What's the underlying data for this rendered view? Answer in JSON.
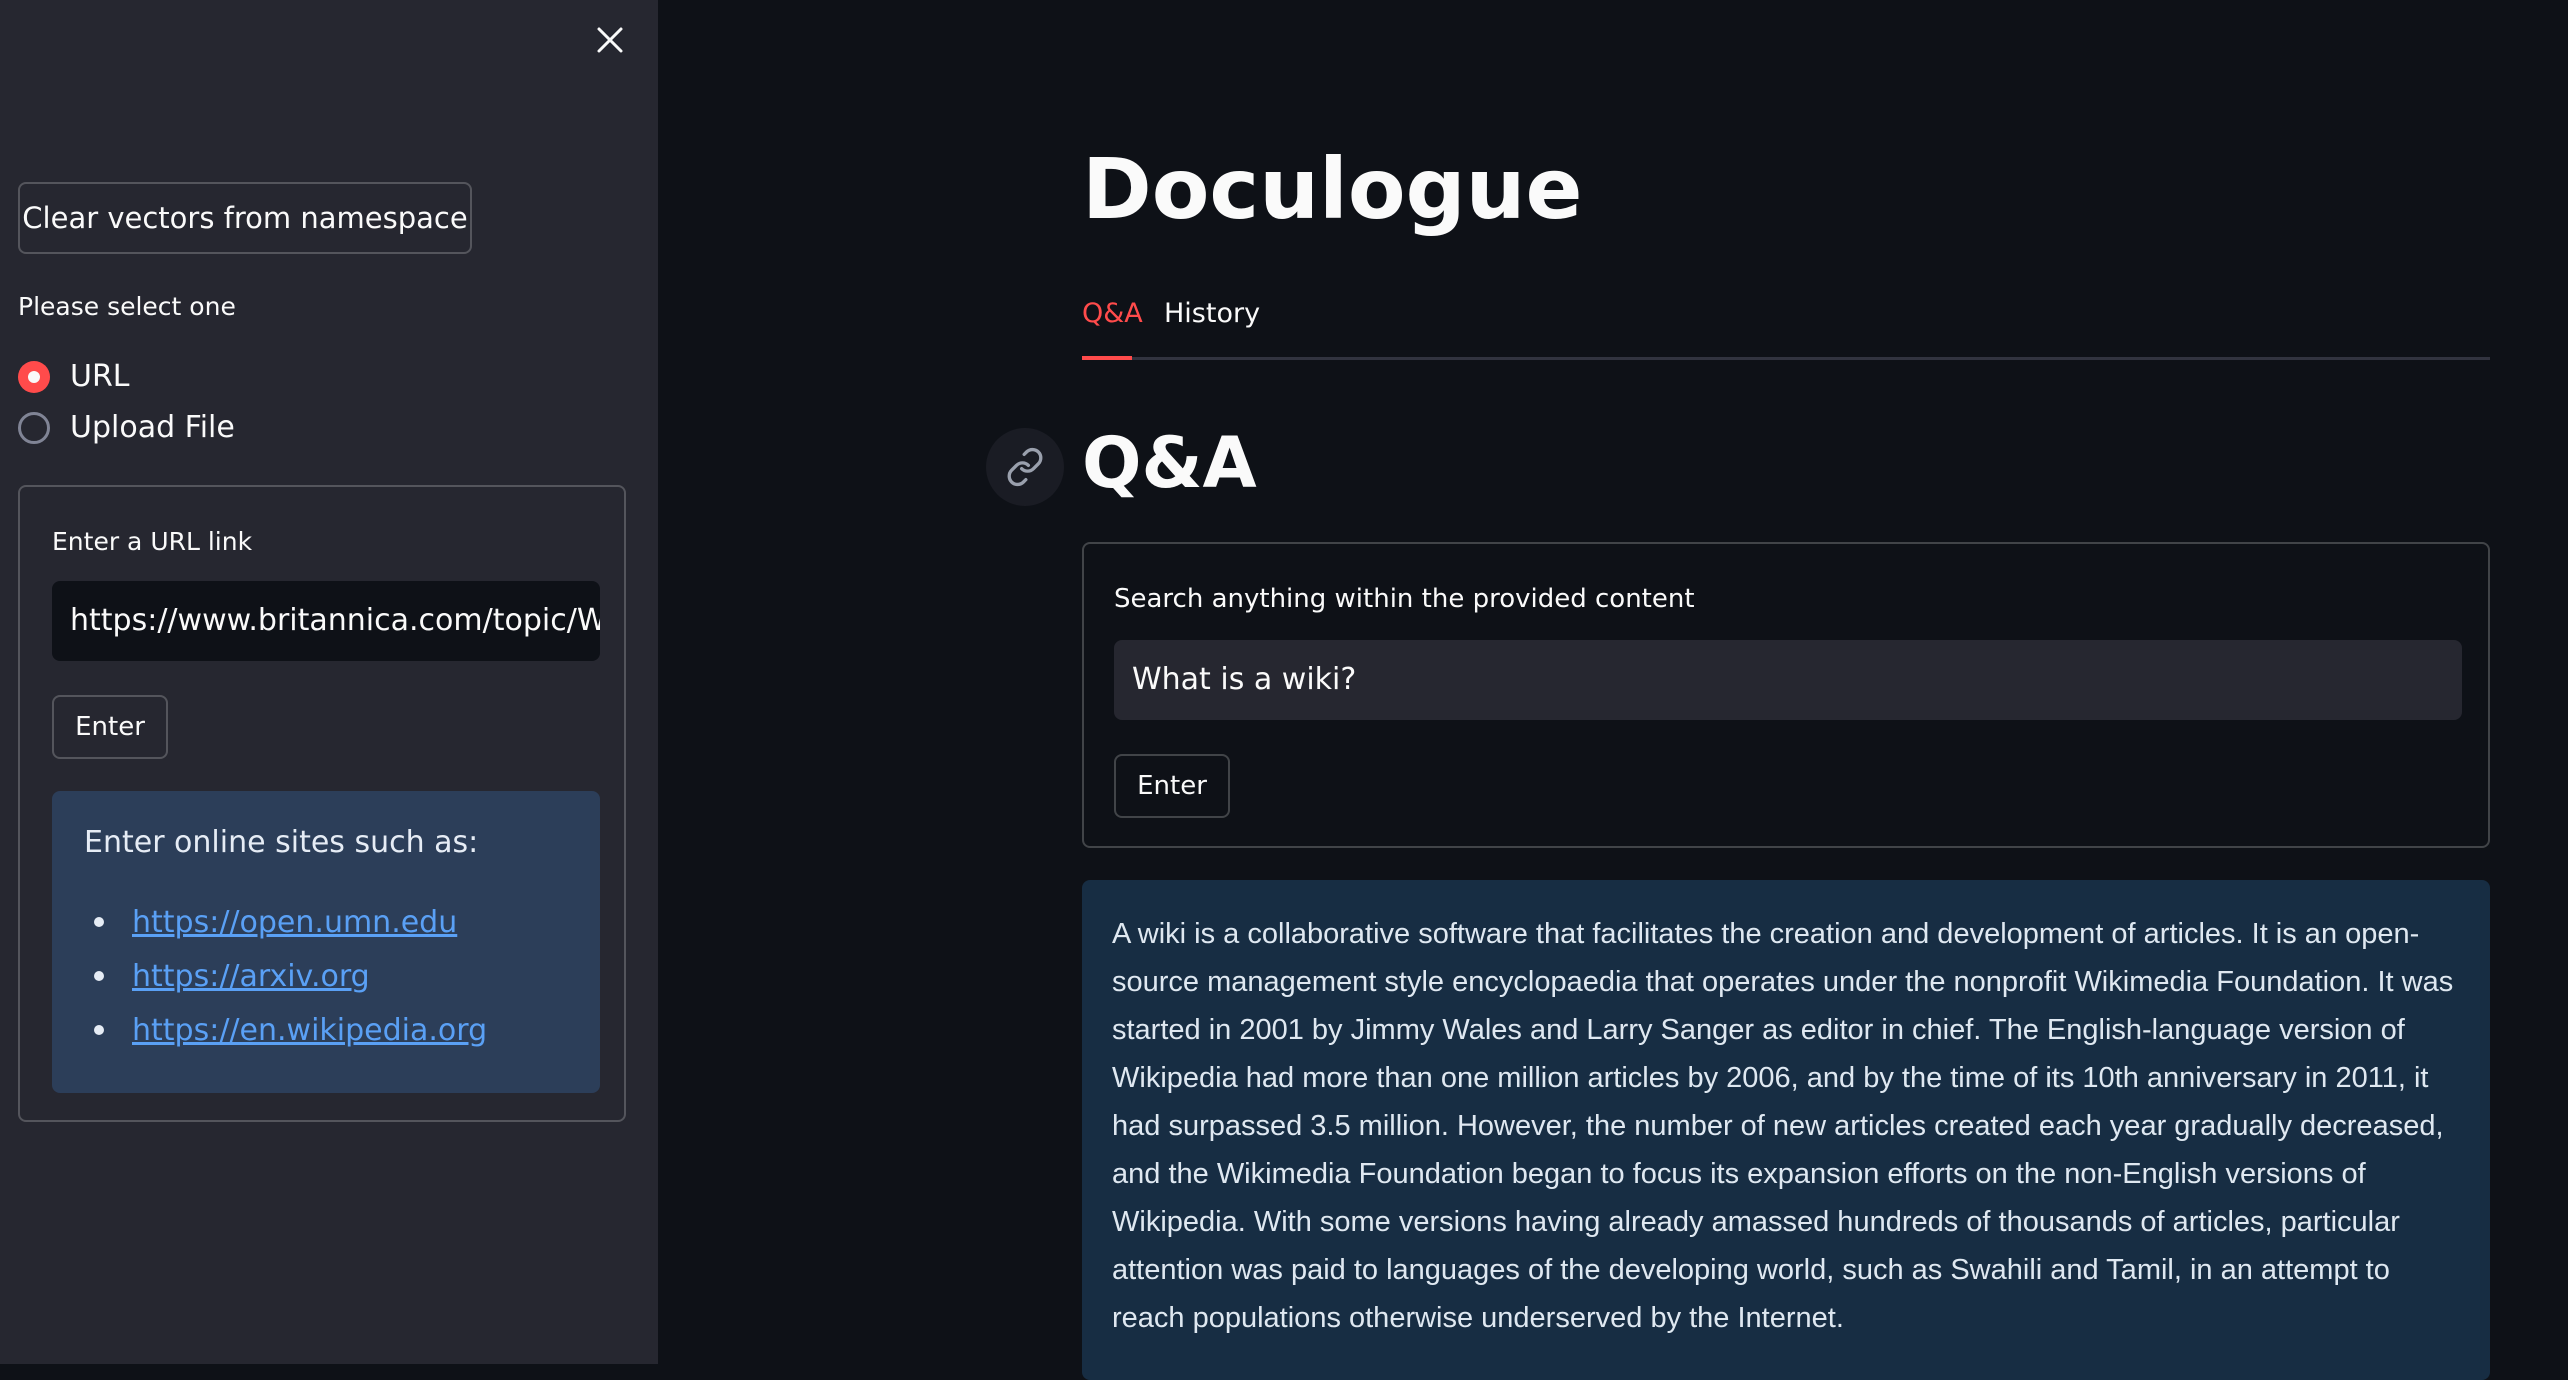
{
  "sidebar": {
    "clear_button": "Clear vectors from namespace",
    "select_label": "Please select one",
    "options": [
      {
        "label": "URL",
        "selected": true
      },
      {
        "label": "Upload File",
        "selected": false
      }
    ],
    "url_label": "Enter a URL link",
    "url_value": "https://www.britannica.com/topic/Wikipedia",
    "enter_label": "Enter",
    "info_title": "Enter online sites such as:",
    "sites": [
      "https://open.umn.edu",
      "https://arxiv.org",
      "https://en.wikipedia.org"
    ]
  },
  "main": {
    "title": "Doculogue",
    "tabs": [
      {
        "label": "Q&A",
        "active": true
      },
      {
        "label": "History",
        "active": false
      }
    ],
    "section_heading": "Q&A",
    "search_label": "Search anything within the provided content",
    "search_value": "What is a wiki?",
    "enter_label": "Enter",
    "answer": "A wiki is a collaborative software that facilitates the creation and development of articles. It is an open-source management style encyclopaedia that operates under the nonprofit Wikimedia Foundation. It was started in 2001 by Jimmy Wales and Larry Sanger as editor in chief. The English-language version of Wikipedia had more than one million articles by 2006, and by the time of its 10th anniversary in 2011, it had surpassed 3.5 million. However, the number of new articles created each year gradually decreased, and the Wikimedia Foundation began to focus its expansion efforts on the non-English versions of Wikipedia. With some versions having already amassed hundreds of thousands of articles, particular attention was paid to languages of the developing world, such as Swahili and Tamil, in an attempt to reach populations otherwise underserved by the Internet."
  },
  "colors": {
    "accent": "#ff4b4b",
    "sidebar_bg": "#262730",
    "main_bg": "#0e1117",
    "info_bg": "#2c3e59",
    "answer_bg": "#172d43",
    "link": "#5aa0f5"
  },
  "icons": [
    "close-icon",
    "link-icon"
  ]
}
